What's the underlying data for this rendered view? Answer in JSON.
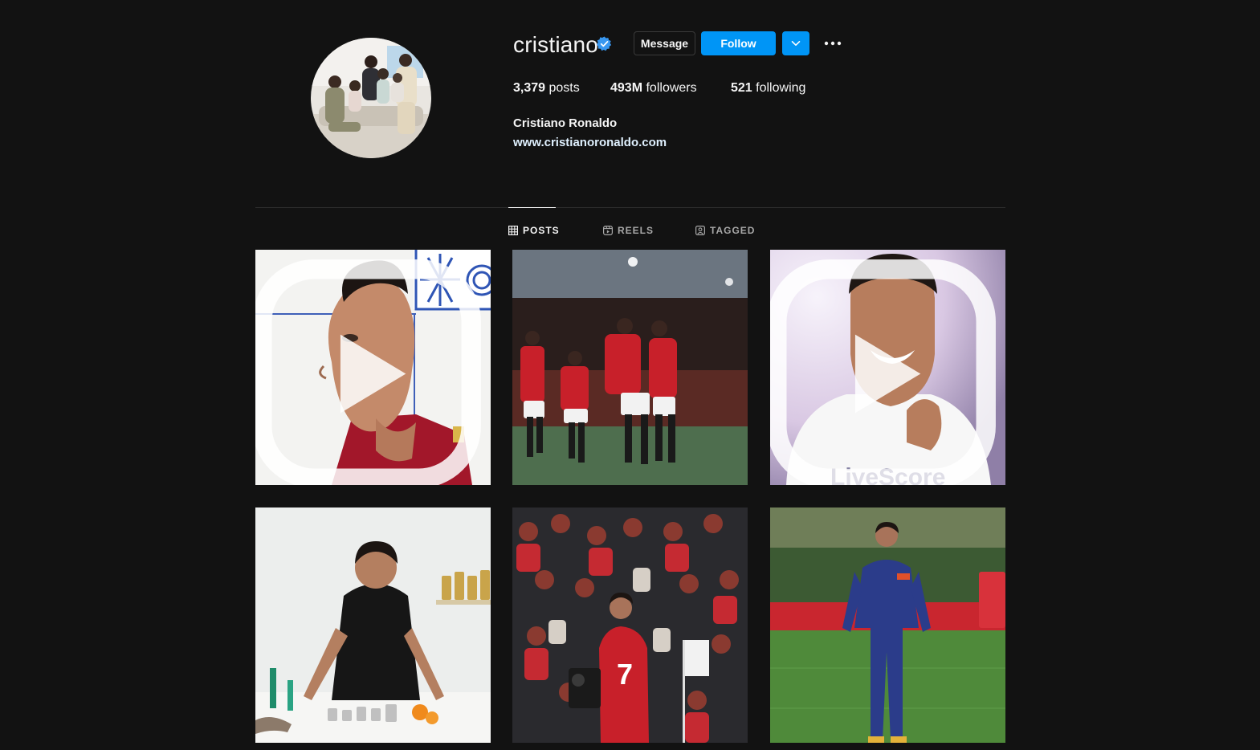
{
  "profile": {
    "username": "cristiano",
    "verified": true,
    "message_label": "Message",
    "follow_label": "Follow",
    "posts_count": "3,379",
    "posts_label": "posts",
    "followers_count": "493M",
    "followers_label": "followers",
    "following_count": "521",
    "following_label": "following",
    "full_name": "Cristiano Ronaldo",
    "website": "www.cristianoronaldo.com"
  },
  "tabs": [
    {
      "label": "POSTS",
      "icon": "grid-icon",
      "active": true
    },
    {
      "label": "REELS",
      "icon": "reels-icon",
      "active": false
    },
    {
      "label": "TAGGED",
      "icon": "tagged-icon",
      "active": false
    }
  ],
  "posts": [
    {
      "subject": "portrait-profile-red-shirt",
      "reel": true
    },
    {
      "subject": "team-celebration-red-kits",
      "reel": false
    },
    {
      "subject": "smiling-white-tshirt",
      "reel": true,
      "shirt_text": "LiveScore"
    },
    {
      "subject": "product-table-black-polo",
      "reel": false
    },
    {
      "subject": "stadium-crowd-number-7",
      "reel": false
    },
    {
      "subject": "training-blue-tracksuit",
      "reel": false
    }
  ],
  "colors": {
    "background": "#121212",
    "accent": "#0095f6",
    "verified": "#3897f0",
    "muted": "#a8a8a8"
  }
}
